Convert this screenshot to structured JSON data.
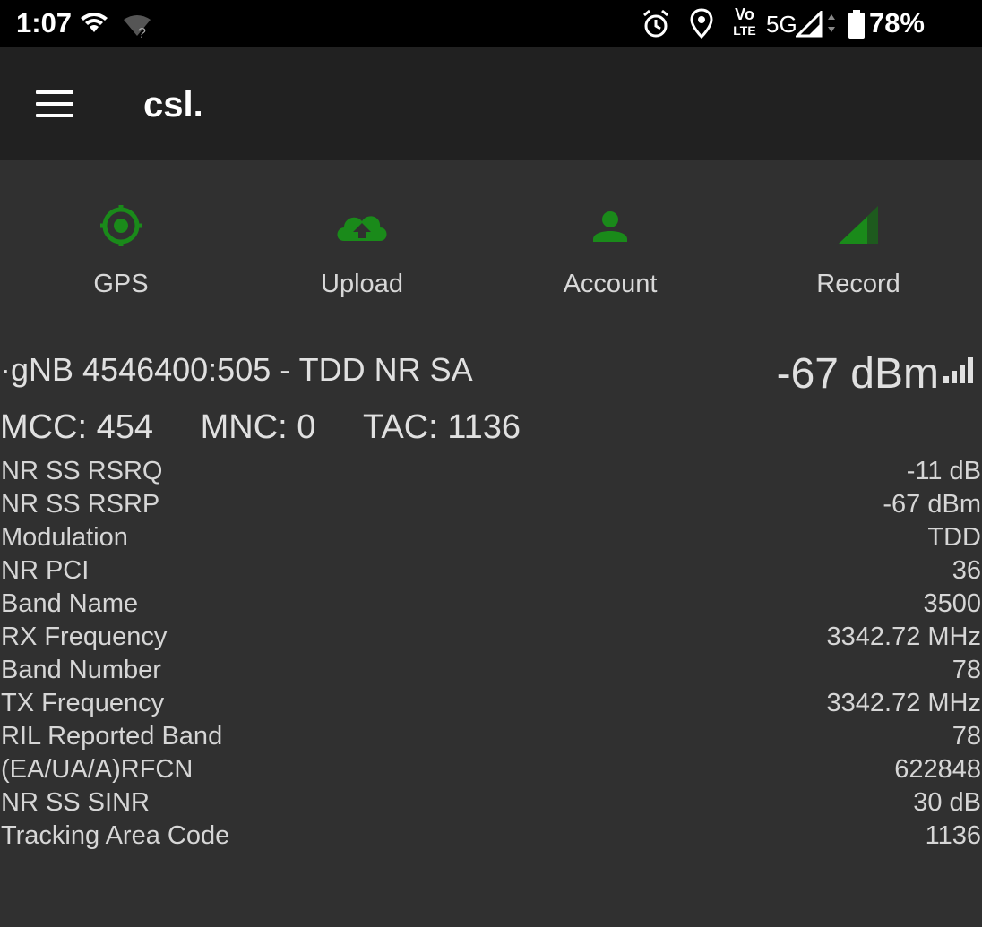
{
  "status_bar": {
    "time": "1:07",
    "battery_percent": "78%",
    "network_label": "5G",
    "volte_top": "Vo",
    "volte_bottom": "LTE",
    "icons": [
      "wifi-icon",
      "wifi-unknown-icon",
      "alarm-icon",
      "location-icon",
      "volte-icon",
      "cell-signal-icon",
      "battery-icon"
    ]
  },
  "app_bar": {
    "title": "csl.",
    "menu_icon": "hamburger-menu-icon"
  },
  "actions": [
    {
      "label": "GPS",
      "icon": "gps-target-icon"
    },
    {
      "label": "Upload",
      "icon": "cloud-upload-icon"
    },
    {
      "label": "Account",
      "icon": "account-icon"
    },
    {
      "label": "Record",
      "icon": "signal-triangle-icon"
    }
  ],
  "accent_color": "#1a8a1a",
  "cell": {
    "title": "·gNB 4546400:505 - TDD NR SA",
    "signal": "-67 dBm",
    "signal_icon": "signal-bars-icon",
    "mcc": "MCC: 454",
    "mnc": "MNC: 0",
    "tac": "TAC: 1136"
  },
  "details": [
    {
      "key": "NR SS RSRQ",
      "value": "-11 dB"
    },
    {
      "key": "NR SS RSRP",
      "value": "-67 dBm"
    },
    {
      "key": "Modulation",
      "value": "TDD"
    },
    {
      "key": "NR PCI",
      "value": "36"
    },
    {
      "key": "Band Name",
      "value": "3500"
    },
    {
      "key": "RX Frequency",
      "value": "3342.72 MHz"
    },
    {
      "key": "Band Number",
      "value": "78"
    },
    {
      "key": "TX Frequency",
      "value": "3342.72 MHz"
    },
    {
      "key": "RIL Reported Band",
      "value": "78"
    },
    {
      "key": "(EA/UA/A)RFCN",
      "value": "622848"
    },
    {
      "key": "NR SS SINR",
      "value": "30 dB"
    },
    {
      "key": "Tracking Area Code",
      "value": "1136"
    }
  ]
}
